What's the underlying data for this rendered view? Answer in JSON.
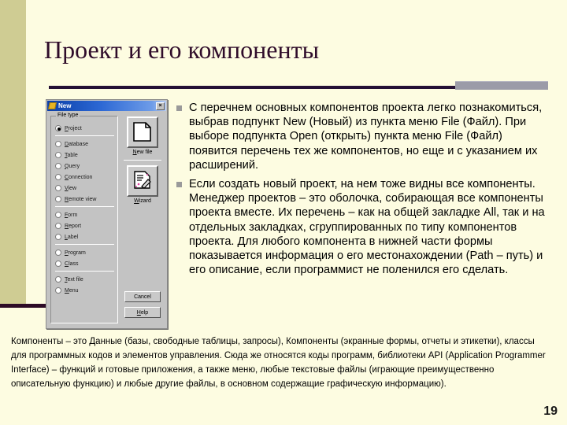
{
  "slide": {
    "title": "Проект и его компоненты",
    "page_number": "19"
  },
  "dialog": {
    "title": "New",
    "title_icon": "new-document-icon",
    "close_label": "×",
    "groupbox_label": "File type",
    "options": [
      {
        "label": "Project",
        "selected": true,
        "group": 0
      },
      {
        "label": "Database",
        "selected": false,
        "group": 1
      },
      {
        "label": "Table",
        "selected": false,
        "group": 1
      },
      {
        "label": "Query",
        "selected": false,
        "group": 1
      },
      {
        "label": "Connection",
        "selected": false,
        "group": 1
      },
      {
        "label": "View",
        "selected": false,
        "group": 1
      },
      {
        "label": "Remote view",
        "selected": false,
        "group": 1
      },
      {
        "label": "Form",
        "selected": false,
        "group": 2
      },
      {
        "label": "Report",
        "selected": false,
        "group": 2
      },
      {
        "label": "Label",
        "selected": false,
        "group": 2
      },
      {
        "label": "Program",
        "selected": false,
        "group": 3
      },
      {
        "label": "Class",
        "selected": false,
        "group": 3
      },
      {
        "label": "Text file",
        "selected": false,
        "group": 4
      },
      {
        "label": "Menu",
        "selected": false,
        "group": 4
      }
    ],
    "new_file_label": "New file",
    "new_file_icon": "blank-page-icon",
    "wizard_label": "Wizard",
    "wizard_icon": "magic-wand-page-icon",
    "cancel_label": "Cancel",
    "help_label": "Help"
  },
  "bullets": [
    "С перечнем основных компонентов проекта легко познакомиться, выбрав подпункт New (Новый) из пункта меню File (Файл). При выборе подпункта Open (открыть) пункта меню File (Файл) появится перечень тех же компонентов, но еще и с указанием их расширений.",
    "Если создать новый проект, на нем тоже видны все компоненты. Менеджер проектов – это оболочка, собирающая все компоненты проекта вместе. Их перечень – как на общей закладке All, так и на отдельных закладках, сгруппированных по типу компонентов проекта. Для любого компонента в нижней части формы показывается информация о его местонахождении (Path – путь) и его описание, если программист не поленился его сделать."
  ],
  "footer": {
    "paragraph": "Компоненты – это Данные (базы, свободные таблицы, запросы), Компоненты (экранные формы, отчеты и этикетки), классы для программных кодов и элементов управления. Сюда же относятся коды программ, библиотеки API (Application Programmer Interface) – функций и готовые приложения, а также меню, любые текстовые файлы (играющие преимущественно описательную функцию) и любые другие файлы, в основном содержащие графическую информацию)."
  },
  "colors": {
    "background": "#fdfce1",
    "band": "#cfcc93",
    "title_text": "#2f0c2a",
    "rule": "#241035",
    "accent_bar": "#9b9ba8",
    "dialog_face": "#c3c3c3",
    "titlebar_blue": "#0a3fa8"
  }
}
